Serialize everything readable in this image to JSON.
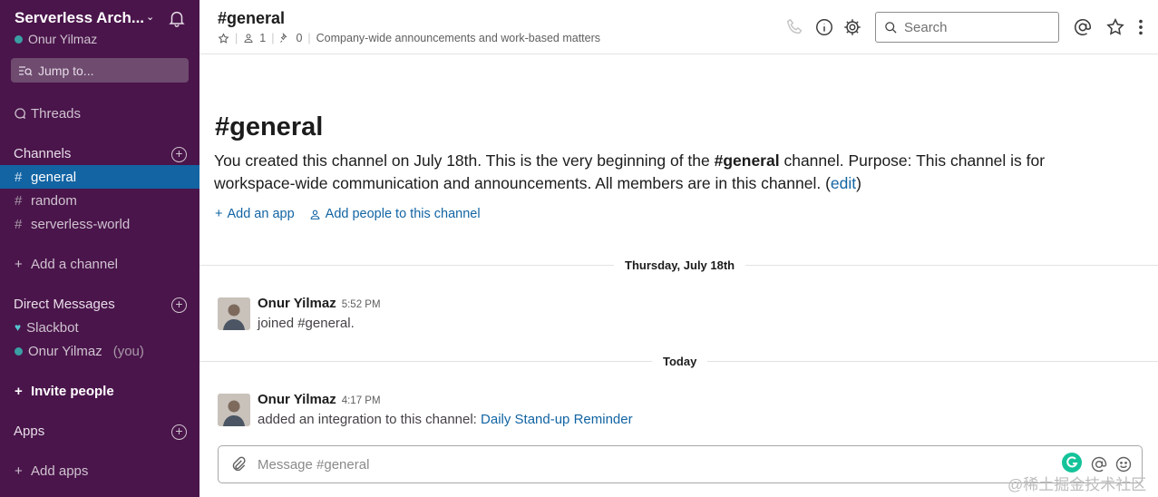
{
  "workspace": {
    "name": "Serverless Arch...",
    "user": "Onur Yilmaz",
    "jump_label": "Jump to..."
  },
  "sidebar": {
    "threads": "Threads",
    "channels_heading": "Channels",
    "channels": [
      "general",
      "random",
      "serverless-world"
    ],
    "add_channel": "Add a channel",
    "dm_heading": "Direct Messages",
    "dms": [
      {
        "name": "Slackbot",
        "suffix": ""
      },
      {
        "name": "Onur Yilmaz",
        "suffix": "(you)"
      }
    ],
    "invite": "Invite people",
    "apps_heading": "Apps",
    "add_apps": "Add apps"
  },
  "header": {
    "title": "#general",
    "members": "1",
    "pins": "0",
    "topic": "Company-wide announcements and work-based matters",
    "search_placeholder": "Search"
  },
  "intro": {
    "title": "#general",
    "text_1": "You created this channel on July 18th. This is the very beginning of the ",
    "channel": "#general",
    "text_2": " channel. Purpose: This channel is for workspace-wide communication and announcements. All members are in this channel. (",
    "edit": "edit",
    "text_3": ")",
    "add_app": "Add an app",
    "add_people": "Add people to this channel"
  },
  "dividers": [
    "Thursday, July 18th",
    "Today"
  ],
  "messages": [
    {
      "author": "Onur Yilmaz",
      "time": "5:52 PM",
      "text": "joined #general.",
      "link": ""
    },
    {
      "author": "Onur Yilmaz",
      "time": "4:17 PM",
      "text": "added an integration to this channel: ",
      "link": "Daily Stand-up Reminder"
    }
  ],
  "composer": {
    "placeholder": "Message #general"
  },
  "watermark": "@稀土掘金技术社区",
  "colors": {
    "sidebar": "#4a154b",
    "active": "#1264a3",
    "link": "#1264a3",
    "presence": "#3a9fa3"
  },
  "icons": [
    "bell-icon",
    "search-icon",
    "star-icon",
    "person-icon",
    "pin-icon",
    "phone-icon",
    "info-icon",
    "gear-icon",
    "at-icon",
    "more-icon",
    "paperclip-icon",
    "emoji-icon",
    "grammarly-icon"
  ]
}
